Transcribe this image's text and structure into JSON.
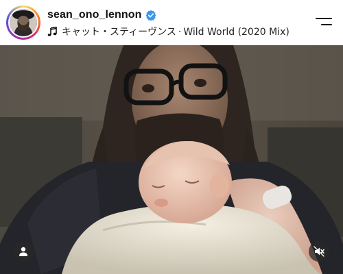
{
  "post": {
    "username": "sean_ono_lennon",
    "verified": true,
    "music": {
      "title": "キャット・スティーヴンス",
      "separator": "·",
      "song": "Wild World (2020 Mix)"
    }
  },
  "icons": {
    "verified": "verified-badge-icon",
    "music": "music-note-icon",
    "menu": "menu-icon",
    "tags": "person-tag-icon",
    "mute": "speaker-muted-icon"
  },
  "colors": {
    "verified": "#3897f0",
    "text": "#111111"
  }
}
